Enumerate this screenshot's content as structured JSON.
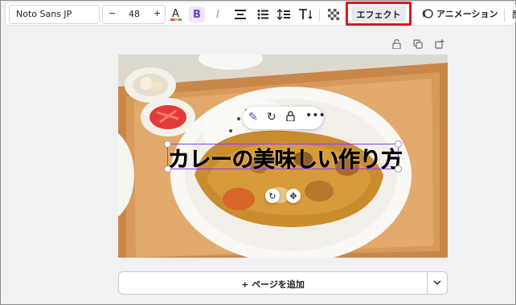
{
  "toolbar": {
    "font_family": "Noto Sans JP",
    "font_size": "48",
    "minus": "−",
    "plus": "+",
    "text_color_glyph": "A",
    "bold_glyph": "B",
    "italic_glyph": "I",
    "effect_label": "エフェクト",
    "animation_label": "アニメーション",
    "extra_label": "配",
    "highlight_color": "#e3141b"
  },
  "canvas": {
    "headline_text": "カレーの美味しい作り方",
    "selection_color": "#8b3dff",
    "add_page_label": "+ ページを追加"
  }
}
